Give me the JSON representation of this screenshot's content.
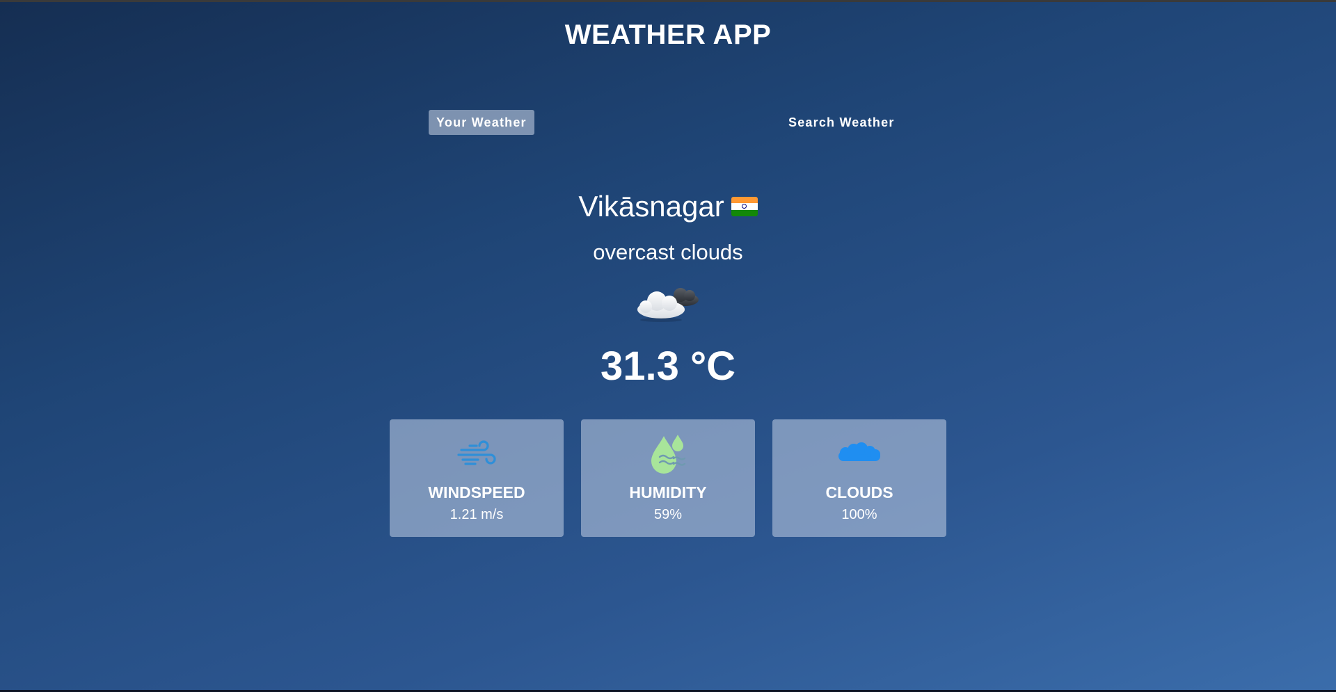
{
  "app": {
    "title": "WEATHER APP"
  },
  "tabs": [
    {
      "label": "Your Weather",
      "active": true
    },
    {
      "label": "Search Weather",
      "active": false
    }
  ],
  "current": {
    "city": "Vikāsnagar",
    "country_flag_icon": "india-flag-icon",
    "description": "overcast clouds",
    "condition_icon": "overcast-clouds-icon",
    "temperature": "31.3 °C"
  },
  "stats": [
    {
      "label": "WINDSPEED",
      "value": "1.21 m/s",
      "icon": "wind-icon"
    },
    {
      "label": "HUMIDITY",
      "value": "59%",
      "icon": "humidity-drops-icon"
    },
    {
      "label": "CLOUDS",
      "value": "100%",
      "icon": "cloud-icon"
    }
  ],
  "colors": {
    "background_top": "#152e52",
    "background_bottom": "#3b6dab",
    "card_bg": "#b1c1db",
    "wind_icon": "#2f8fd8",
    "humidity_icon": "#a8e59a",
    "cloud_icon": "#1f8ef1"
  }
}
